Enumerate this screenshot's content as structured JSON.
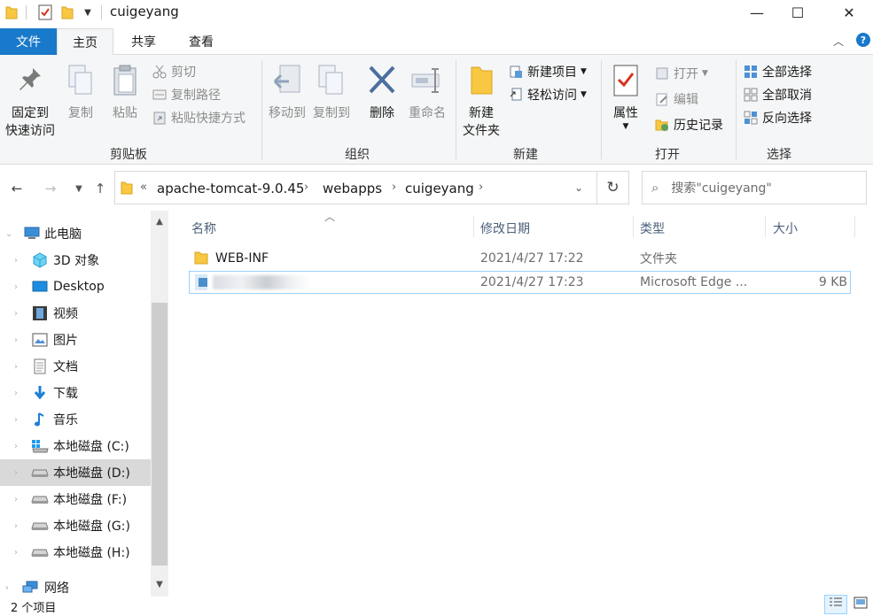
{
  "window": {
    "title": "cuigeyang",
    "controls": {
      "minimize": "—",
      "maximize": "☐",
      "close": "✕"
    }
  },
  "tabs": [
    {
      "label": "文件"
    },
    {
      "label": "主页"
    },
    {
      "label": "共享"
    },
    {
      "label": "查看"
    }
  ],
  "ribbon": {
    "clipboard": {
      "group_label": "剪贴板",
      "pin_label": "固定到\n快速访问",
      "copy_label": "复制",
      "paste_label": "粘贴",
      "cut_label": "剪切",
      "copy_path_label": "复制路径",
      "paste_shortcut_label": "粘贴快捷方式"
    },
    "organize": {
      "group_label": "组织",
      "move_to_label": "移动到",
      "copy_to_label": "复制到",
      "delete_label": "删除",
      "rename_label": "重命名"
    },
    "new": {
      "group_label": "新建",
      "new_folder_label": "新建\n文件夹",
      "new_item_label": "新建项目",
      "easy_access_label": "轻松访问"
    },
    "open": {
      "group_label": "打开",
      "properties_label": "属性",
      "open_label": "打开",
      "edit_label": "编辑",
      "history_label": "历史记录"
    },
    "select": {
      "group_label": "选择",
      "select_all_label": "全部选择",
      "select_none_label": "全部取消",
      "invert_label": "反向选择"
    }
  },
  "address": {
    "overflow": "«",
    "crumbs": [
      "apache-tomcat-9.0.45",
      "webapps",
      "cuigeyang"
    ],
    "search_placeholder": "搜索\"cuigeyang\""
  },
  "sidebar": {
    "items": [
      {
        "label": "此电脑",
        "icon": "computer-icon"
      },
      {
        "label": "3D 对象",
        "icon": "3d-objects-icon"
      },
      {
        "label": "Desktop",
        "icon": "desktop-icon"
      },
      {
        "label": "视频",
        "icon": "video-icon"
      },
      {
        "label": "图片",
        "icon": "pictures-icon"
      },
      {
        "label": "文档",
        "icon": "documents-icon"
      },
      {
        "label": "下载",
        "icon": "download-icon"
      },
      {
        "label": "音乐",
        "icon": "music-icon"
      },
      {
        "label": "本地磁盘 (C:)",
        "icon": "windows-drive-icon"
      },
      {
        "label": "本地磁盘 (D:)",
        "icon": "drive-icon",
        "selected": true
      },
      {
        "label": "本地磁盘 (F:)",
        "icon": "drive-icon"
      },
      {
        "label": "本地磁盘 (G:)",
        "icon": "drive-icon"
      },
      {
        "label": "本地磁盘 (H:)",
        "icon": "drive-icon"
      },
      {
        "label": "网络",
        "icon": "network-icon"
      }
    ]
  },
  "columns": {
    "name": "名称",
    "modified": "修改日期",
    "type": "类型",
    "size": "大小"
  },
  "files": [
    {
      "name": "WEB-INF",
      "modified": "2021/4/27 17:22",
      "type": "文件夹",
      "size": ""
    },
    {
      "name": "",
      "modified": "2021/4/27 17:23",
      "type": "Microsoft Edge ...",
      "size": "9 KB"
    }
  ],
  "status": {
    "item_count": "2 个项目"
  },
  "colors": {
    "accent": "#1979ca",
    "folder": "#f8c843",
    "selection_border": "#99d1ff",
    "selected_nav": "#d9d9d9"
  }
}
